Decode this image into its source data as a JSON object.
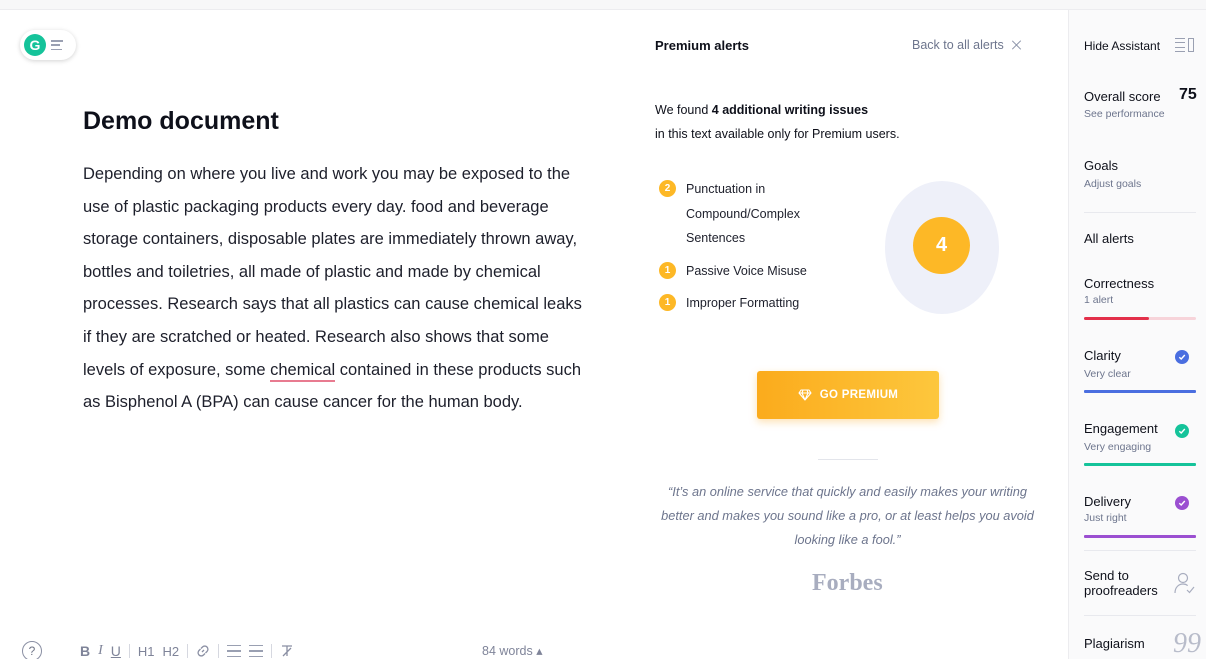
{
  "app": {
    "logo_letter": "G"
  },
  "document": {
    "title": "Demo document",
    "body_before": "Depending on where you live and work you may be exposed to the use of plastic packaging products every day. food and beverage storage containers, disposable plates are immediately thrown away, bottles and toiletries, all made of plastic and made by chemical processes. Research says that all plastics can cause chemical leaks if they are scratched or heated. Research also shows that some levels of exposure, some ",
    "body_flagged_word": "chemical",
    "body_after": " contained in these products such as Bisphenol A (BPA) can cause cancer for the human body."
  },
  "toolbar": {
    "help": "?",
    "bold": "B",
    "italic": "I",
    "underline": "U",
    "h1": "H1",
    "h2": "H2",
    "word_count": "84 words ▴"
  },
  "premium_panel": {
    "title": "Premium alerts",
    "back_link": "Back to all alerts",
    "found_prefix": "We found ",
    "found_bold": "4 additional writing issues",
    "found_suffix": "in this text available only for Premium users.",
    "issues": [
      {
        "count": "2",
        "label": "Punctuation in Compound/Complex Sentences"
      },
      {
        "count": "1",
        "label": "Passive Voice Misuse"
      },
      {
        "count": "1",
        "label": "Improper Formatting"
      }
    ],
    "total": "4",
    "cta": "GO PREMIUM",
    "quote": "“It’s an online service that quickly and easily makes your writing better and makes you sound like a pro, or at least helps you avoid looking like a fool.”",
    "quote_source": "Forbes"
  },
  "sidebar": {
    "hide_assistant": "Hide Assistant",
    "overall_score_label": "Overall score",
    "overall_score_value": "75",
    "see_performance": "See performance",
    "goals_label": "Goals",
    "goals_sub": "Adjust goals",
    "all_alerts": "All alerts",
    "categories": [
      {
        "name": "Correctness",
        "status": "1 alert",
        "color": "#e3304a",
        "track": "#f7d4da",
        "fill": 0.58
      },
      {
        "name": "Clarity",
        "status": "Very clear",
        "color": "#4a6ee0",
        "track": "#4a6ee0",
        "fill": 1.0
      },
      {
        "name": "Engagement",
        "status": "Very engaging",
        "color": "#15c39a",
        "track": "#15c39a",
        "fill": 1.0
      },
      {
        "name": "Delivery",
        "status": "Just right",
        "color": "#9b4fd1",
        "track": "#9b4fd1",
        "fill": 1.0
      }
    ],
    "send_to_proofreaders": "Send to proofreaders",
    "plagiarism": "Plagiarism",
    "plagiarism_icon": "99"
  },
  "colors": {
    "brand_green": "#15c39a",
    "premium_orange": "#fdb826"
  },
  "icons": {
    "menu": "menu-icon",
    "close": "close-icon",
    "diamond": "diamond-icon",
    "check": "check-icon",
    "person": "person-icon",
    "quote": "quote-icon"
  }
}
